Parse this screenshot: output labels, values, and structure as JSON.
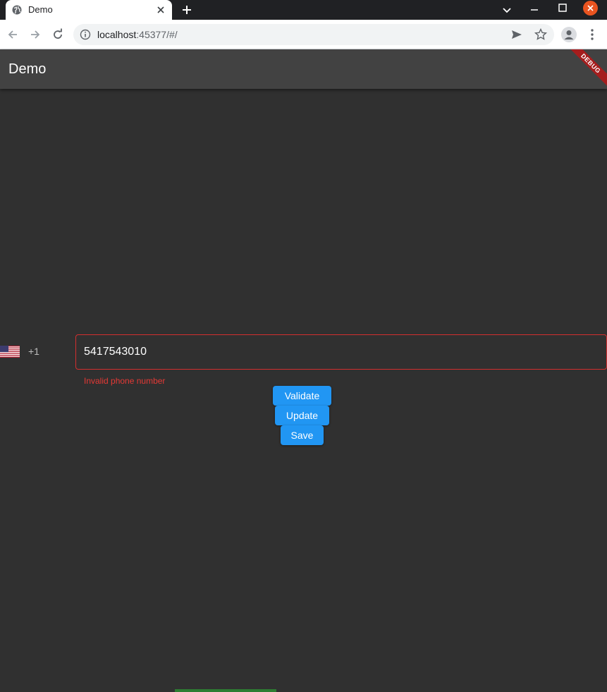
{
  "browser": {
    "tab_title": "Demo",
    "url_host": "localhost",
    "url_rest": ":45377/#/"
  },
  "app": {
    "title": "Demo",
    "debug_label": "DEBUG"
  },
  "phone": {
    "country_flag": "us-flag-icon",
    "dial_code": "+1",
    "value": "5417543010",
    "error": "Invalid phone number"
  },
  "buttons": {
    "validate": "Validate",
    "update": "Update",
    "save": "Save"
  },
  "colors": {
    "accent": "#2196f3",
    "error": "#d32f2f",
    "background": "#303030",
    "appbar": "#424242"
  }
}
